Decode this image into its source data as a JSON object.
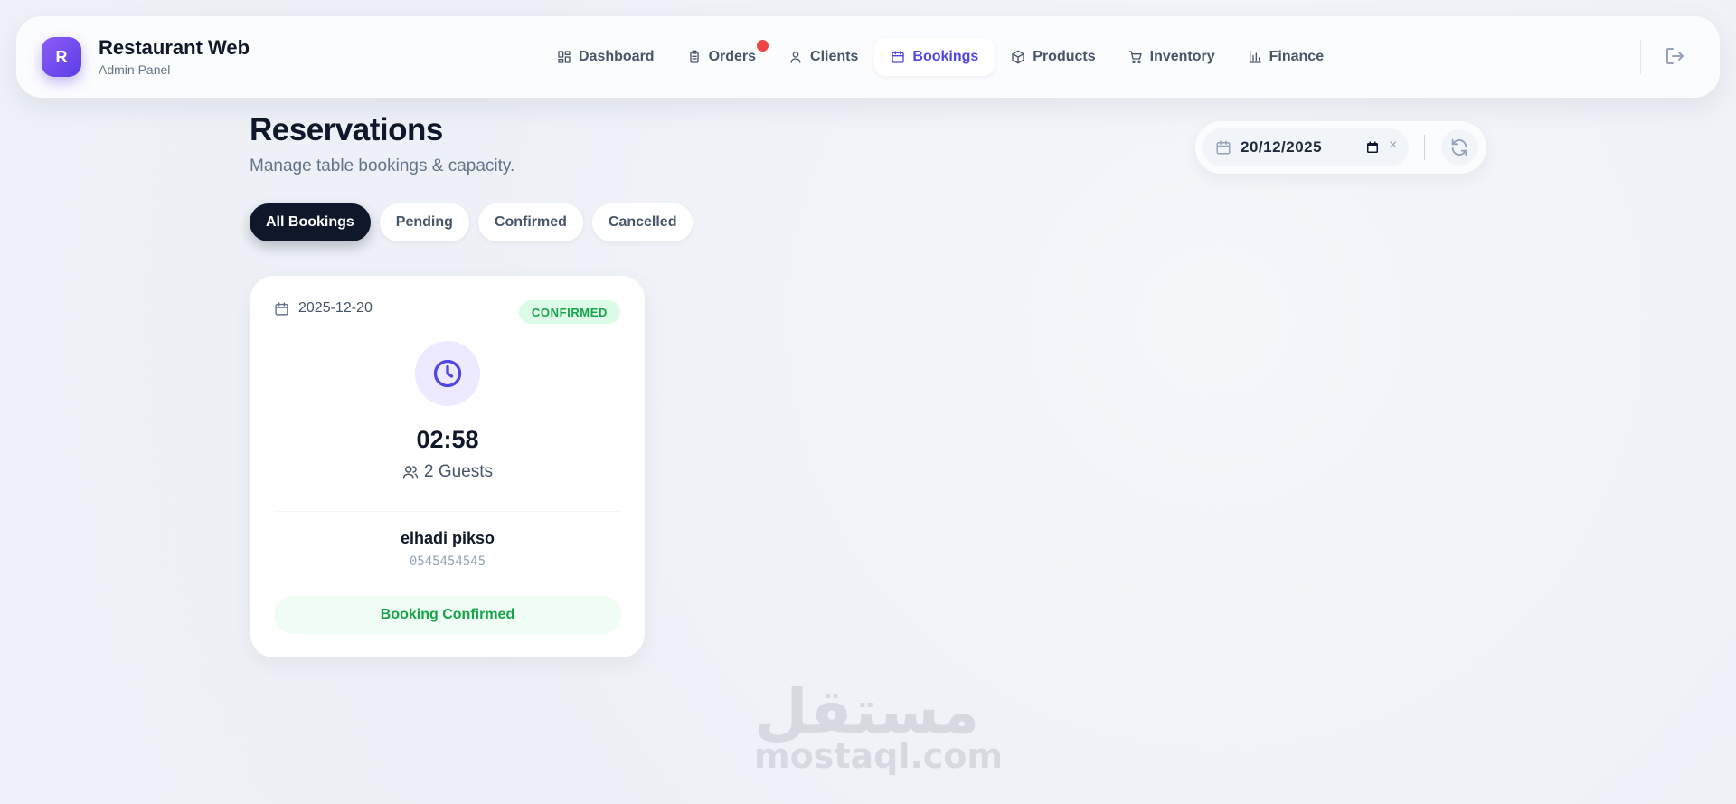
{
  "brand": {
    "initial": "R",
    "title": "Restaurant Web",
    "subtitle": "Admin Panel"
  },
  "nav": {
    "items": [
      {
        "label": "Dashboard",
        "icon": "dashboard-icon",
        "active": false
      },
      {
        "label": "Orders",
        "icon": "clipboard-icon",
        "active": false,
        "notification_dot": true
      },
      {
        "label": "Clients",
        "icon": "user-icon",
        "active": false
      },
      {
        "label": "Bookings",
        "icon": "calendar-icon",
        "active": true
      },
      {
        "label": "Products",
        "icon": "box-icon",
        "active": false
      },
      {
        "label": "Inventory",
        "icon": "cart-icon",
        "active": false
      },
      {
        "label": "Finance",
        "icon": "bar-chart-icon",
        "active": false
      }
    ],
    "logout_icon": "logout-icon"
  },
  "page": {
    "title": "Reservations",
    "subtitle": "Manage table bookings & capacity."
  },
  "date_filter": {
    "value": "20/12/2025",
    "clear_symbol": "×"
  },
  "filters": [
    {
      "label": "All Bookings",
      "active": true
    },
    {
      "label": "Pending",
      "active": false
    },
    {
      "label": "Confirmed",
      "active": false
    },
    {
      "label": "Cancelled",
      "active": false
    }
  ],
  "bookings": [
    {
      "date": "2025-12-20",
      "status_badge": "CONFIRMED",
      "time": "02:58",
      "guests": "2 Guests",
      "client_name": "elhadi pikso",
      "phone": "0545454545",
      "status_label": "Booking Confirmed"
    }
  ],
  "watermark": {
    "arabic": "مستقل",
    "latin": "mostaql.com"
  },
  "colors": {
    "accent": "#4f46e5",
    "brand_gradient_start": "#8b5cf6",
    "brand_gradient_end": "#5b3ee6",
    "active_filter": "#0f172a",
    "success": "#16a34a",
    "notification": "#ef4444"
  }
}
